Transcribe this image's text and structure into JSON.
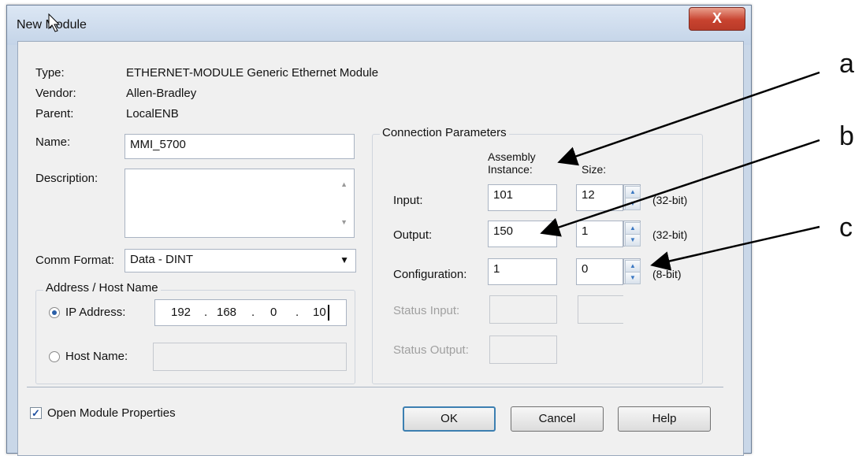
{
  "window": {
    "title": "New Module",
    "close_glyph": "X"
  },
  "info": {
    "type_label": "Type:",
    "type_value": "ETHERNET-MODULE Generic Ethernet Module",
    "vendor_label": "Vendor:",
    "vendor_value": "Allen-Bradley",
    "parent_label": "Parent:",
    "parent_value": "LocalENB",
    "name_label": "Name:",
    "name_value": "MMI_5700",
    "description_label": "Description:",
    "description_value": ""
  },
  "comm_format": {
    "label": "Comm Format:",
    "value": "Data - DINT"
  },
  "address": {
    "group_title": "Address / Host Name",
    "ip_label": "IP Address:",
    "ip_selected": true,
    "ip_octets": [
      "192",
      "168",
      "0",
      "10"
    ],
    "host_label": "Host Name:",
    "host_value": ""
  },
  "connection": {
    "group_title": "Connection Parameters",
    "col_assembly_line1": "Assembly",
    "col_assembly_line2": "Instance:",
    "col_size": "Size:",
    "rows": [
      {
        "label": "Input:",
        "instance": "101",
        "size": "12",
        "unit": "(32-bit)"
      },
      {
        "label": "Output:",
        "instance": "150",
        "size": "1",
        "unit": "(32-bit)"
      },
      {
        "label": "Configuration:",
        "instance": "1",
        "size": "0",
        "unit": "(8-bit)"
      }
    ],
    "status_input_label": "Status Input:",
    "status_output_label": "Status Output:"
  },
  "footer": {
    "open_props_label": "Open Module Properties",
    "open_props_checked": true,
    "ok_label": "OK",
    "cancel_label": "Cancel",
    "help_label": "Help"
  },
  "annotations": [
    "a",
    "b",
    "c"
  ],
  "colors": {
    "accent": "#3c7fb1",
    "close": "#c8432f"
  }
}
